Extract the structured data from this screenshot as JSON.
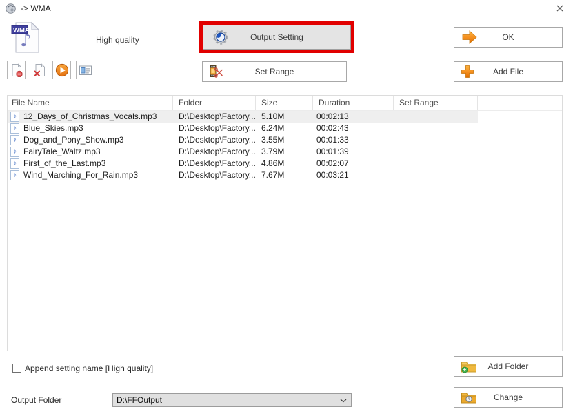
{
  "colors": {
    "highlight_red": "#e10000",
    "accent_orange": "#f08a1d",
    "folder_yellow": "#f0bc45",
    "selection_bg": "#efefef",
    "button_face": "#e4e4e4"
  },
  "titlebar": {
    "title": "-> WMA",
    "icons": {
      "app": "format-factory-logo",
      "close": "close-x"
    }
  },
  "top": {
    "preset_label": "High quality",
    "output_setting_label": "Output Setting",
    "ok_label": "OK",
    "set_range_label": "Set Range",
    "add_file_label": "Add File",
    "toolbar_icons": [
      "remove-file-page-minus",
      "clear-list-page-x",
      "play-preview",
      "media-info-options"
    ],
    "button_icons": {
      "output_setting": "gear-blue-swirl",
      "ok": "orange-arrow-right",
      "set_range": "filmstrip-scissors",
      "add_file": "orange-plus"
    }
  },
  "table": {
    "columns": [
      {
        "label": "File Name"
      },
      {
        "label": "Folder"
      },
      {
        "label": "Size"
      },
      {
        "label": "Duration"
      },
      {
        "label": "Set Range"
      }
    ],
    "rows": [
      {
        "name": "12_Days_of_Christmas_Vocals.mp3",
        "folder": "D:\\Desktop\\Factory...",
        "size": "5.10M",
        "duration": "00:02:13",
        "set_range": "",
        "selected": true
      },
      {
        "name": "Blue_Skies.mp3",
        "folder": "D:\\Desktop\\Factory...",
        "size": "6.24M",
        "duration": "00:02:43",
        "set_range": "",
        "selected": false
      },
      {
        "name": "Dog_and_Pony_Show.mp3",
        "folder": "D:\\Desktop\\Factory...",
        "size": "3.55M",
        "duration": "00:01:33",
        "set_range": "",
        "selected": false
      },
      {
        "name": "FairyTale_Waltz.mp3",
        "folder": "D:\\Desktop\\Factory...",
        "size": "3.79M",
        "duration": "00:01:39",
        "set_range": "",
        "selected": false
      },
      {
        "name": "First_of_the_Last.mp3",
        "folder": "D:\\Desktop\\Factory...",
        "size": "4.86M",
        "duration": "00:02:07",
        "set_range": "",
        "selected": false
      },
      {
        "name": "Wind_Marching_For_Rain.mp3",
        "folder": "D:\\Desktop\\Factory...",
        "size": "7.67M",
        "duration": "00:03:21",
        "set_range": "",
        "selected": false
      }
    ],
    "row_icon": "music-note"
  },
  "footer": {
    "append_checkbox_label": "Append setting name [High quality]",
    "append_checked": false,
    "output_folder_label": "Output Folder",
    "output_folder_value": "D:\\FFOutput",
    "add_folder_label": "Add Folder",
    "change_label": "Change",
    "button_icons": {
      "add_folder": "folder-plus-green",
      "change": "folder-clock"
    }
  }
}
